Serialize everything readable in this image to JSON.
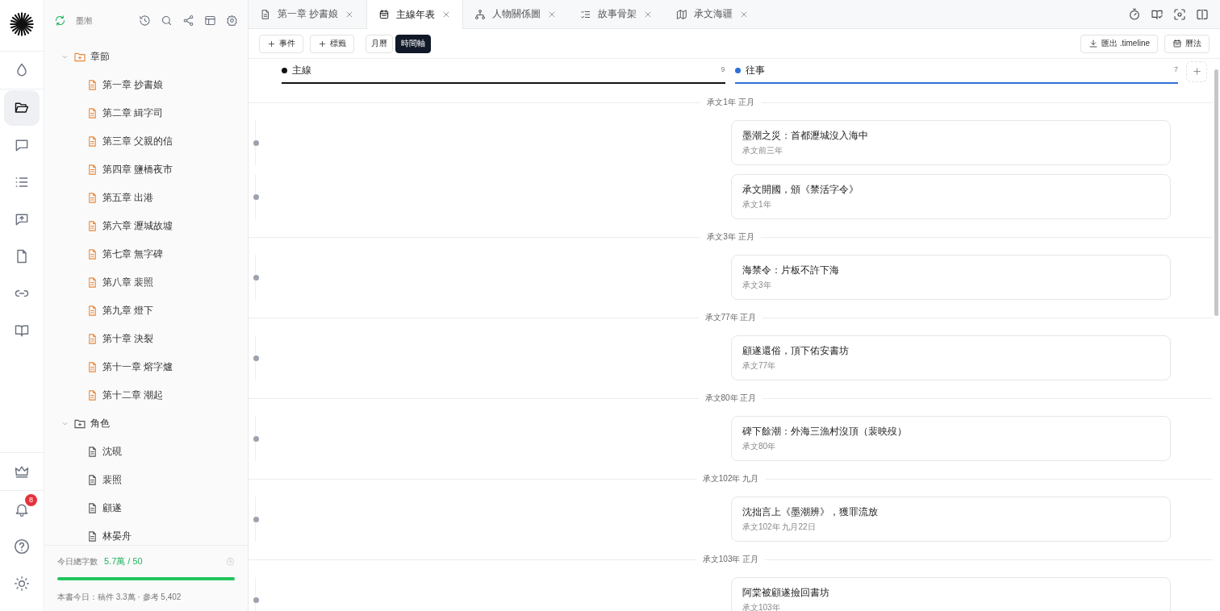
{
  "rail": {
    "items": [
      {
        "selected": false
      },
      {
        "selected": true
      },
      {
        "selected": false
      },
      {
        "selected": false
      },
      {
        "selected": false
      },
      {
        "selected": false
      },
      {
        "selected": false
      },
      {
        "selected": false
      }
    ],
    "notification_count": "8"
  },
  "sidebar": {
    "title": "墨潮",
    "tree": [
      {
        "label": "章節",
        "expanded": true,
        "children": [
          {
            "label": "第一章 抄書娘",
            "kind": "draft"
          },
          {
            "label": "第二章 緝字司",
            "kind": "draft"
          },
          {
            "label": "第三章 父親的信",
            "kind": "draft"
          },
          {
            "label": "第四章 鹽橋夜市",
            "kind": "draft"
          },
          {
            "label": "第五章 出港",
            "kind": "draft"
          },
          {
            "label": "第六章 瀝城故墟",
            "kind": "draft"
          },
          {
            "label": "第七章 無字碑",
            "kind": "draft"
          },
          {
            "label": "第八章 裴照",
            "kind": "draft"
          },
          {
            "label": "第九章 燈下",
            "kind": "draft"
          },
          {
            "label": "第十章 決裂",
            "kind": "draft"
          },
          {
            "label": "第十一章 熔字爐",
            "kind": "draft"
          },
          {
            "label": "第十二章 潮起",
            "kind": "draft"
          }
        ]
      },
      {
        "label": "角色",
        "expanded": true,
        "children": [
          {
            "label": "沈硯",
            "kind": "note"
          },
          {
            "label": "裴照",
            "kind": "note"
          },
          {
            "label": "顧遂",
            "kind": "note"
          },
          {
            "label": "林晏舟",
            "kind": "note"
          }
        ]
      }
    ],
    "footer": {
      "label": "今日總字數",
      "value": "5.7萬 / 50",
      "level": 1,
      "stats": "本書今日：稿件 3.3萬 · 參考 5,402"
    }
  },
  "tabs": [
    {
      "label": "第一章 抄書娘",
      "kind": "doc",
      "selected": false
    },
    {
      "label": "主線年表",
      "kind": "calendar",
      "selected": true
    },
    {
      "label": "人物關係圖",
      "kind": "graph",
      "selected": false
    },
    {
      "label": "故事骨架",
      "kind": "outline",
      "selected": false
    },
    {
      "label": "承文海疆",
      "kind": "map",
      "selected": false
    }
  ],
  "toolbar": {
    "add_buttons": [
      "事件",
      "標籤"
    ],
    "views": [
      {
        "label": "月曆",
        "selected": false
      },
      {
        "label": "時間軸",
        "selected": true
      }
    ],
    "actions": [
      {
        "label": "匯出 .timeline",
        "kind": "export"
      },
      {
        "label": "曆法",
        "kind": "calendar"
      }
    ]
  },
  "timeline": {
    "lanes": [
      {
        "name": "主線",
        "color": "#111111",
        "count": "9"
      },
      {
        "name": "往事",
        "color": "#2f6fd6",
        "count": "7"
      }
    ],
    "groups": [
      {
        "period": "承文1年 正月",
        "events": [
          {
            "title": "墨潮之災：首都瀝城沒入海中",
            "date": "承文前三年"
          },
          {
            "title": "承文開國，頒《禁活字令》",
            "date": "承文1年"
          }
        ]
      },
      {
        "period": "承文3年 正月",
        "events": [
          {
            "title": "海禁令：片板不許下海",
            "date": "承文3年"
          }
        ]
      },
      {
        "period": "承文77年 正月",
        "events": [
          {
            "title": "顧遂還俗，頂下佑安書坊",
            "date": "承文77年"
          }
        ]
      },
      {
        "period": "承文80年 正月",
        "events": [
          {
            "title": "碑下餘潮：外海三漁村沒頂（裴映歿）",
            "date": "承文80年"
          }
        ]
      },
      {
        "period": "承文102年 九月",
        "events": [
          {
            "title": "沈拙言上《墨潮辨》，獲罪流放",
            "date": "承文102年 九月22日"
          }
        ]
      },
      {
        "period": "承文103年 正月",
        "events": [
          {
            "title": "阿棠被顧遂撿回書坊",
            "date": "承文103年"
          }
        ]
      }
    ]
  }
}
